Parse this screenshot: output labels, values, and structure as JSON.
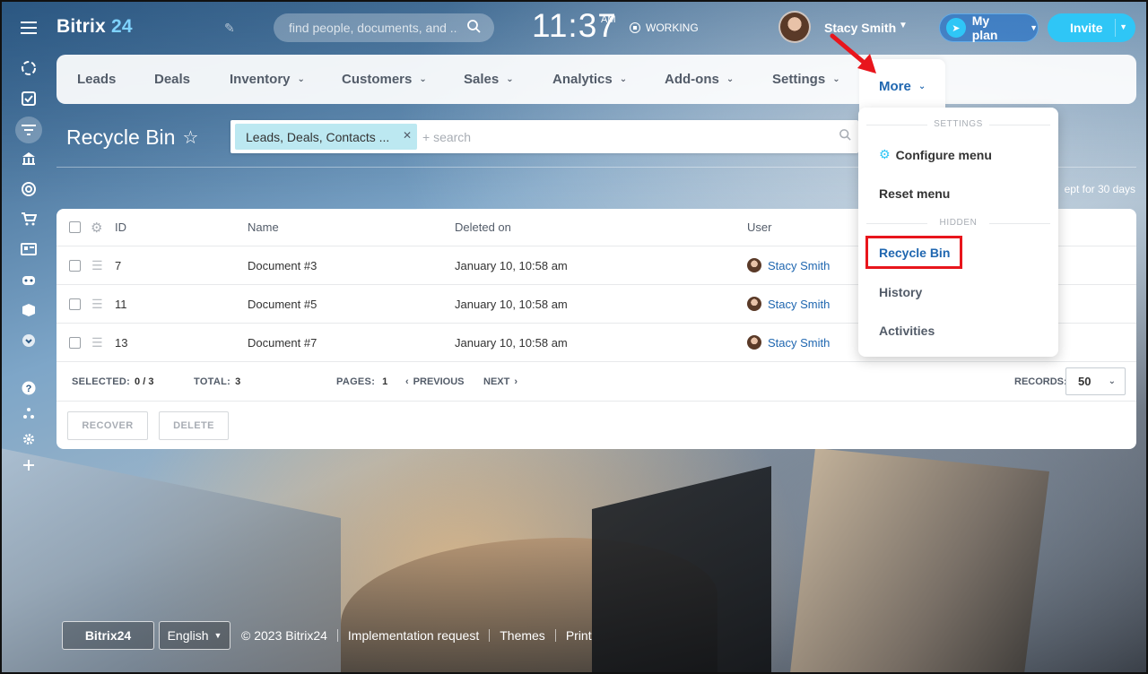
{
  "header": {
    "brand_main": "Bitrix",
    "brand_num": "24",
    "search_placeholder": "find people, documents, and ...",
    "time": "11:37",
    "ampm": "AM",
    "working_label": "WORKING",
    "user_name": "Stacy Smith",
    "myplan_label": "My plan",
    "invite_label": "Invite"
  },
  "sidebar": {
    "icons": [
      "menu-icon",
      "activity-stream-icon",
      "tasks-icon",
      "crm-icon",
      "bank-icon",
      "target-icon",
      "cart-icon",
      "contacts-card-icon",
      "robot-icon",
      "box-icon",
      "chevron-more-icon",
      "help-icon",
      "sitemap-icon",
      "gear-icon",
      "plus-icon"
    ]
  },
  "tabs": [
    {
      "label": "Leads",
      "dropdown": false
    },
    {
      "label": "Deals",
      "dropdown": false
    },
    {
      "label": "Inventory",
      "dropdown": true
    },
    {
      "label": "Customers",
      "dropdown": true
    },
    {
      "label": "Sales",
      "dropdown": true
    },
    {
      "label": "Analytics",
      "dropdown": true
    },
    {
      "label": "Add-ons",
      "dropdown": true
    },
    {
      "label": "Settings",
      "dropdown": true
    },
    {
      "label": "More",
      "dropdown": true
    }
  ],
  "page": {
    "title": "Recycle Bin",
    "filter_chip": "Leads, Deals, Contacts ...",
    "filter_placeholder": "+ search",
    "kept_note": "ept for 30 days"
  },
  "grid": {
    "columns": [
      "ID",
      "Name",
      "Deleted on",
      "User"
    ],
    "rows": [
      {
        "id": "7",
        "name": "Document #3",
        "deleted_on": "January 10, 10:58 am",
        "user": "Stacy Smith"
      },
      {
        "id": "11",
        "name": "Document #5",
        "deleted_on": "January 10, 10:58 am",
        "user": "Stacy Smith"
      },
      {
        "id": "13",
        "name": "Document #7",
        "deleted_on": "January 10, 10:58 am",
        "user": "Stacy Smith"
      }
    ],
    "footer": {
      "selected_label": "SELECTED:",
      "selected_value": "0 / 3",
      "total_label": "TOTAL:",
      "total_value": "3",
      "pages_label": "PAGES:",
      "pages_value": "1",
      "previous_label": "PREVIOUS",
      "next_label": "NEXT",
      "records_label": "RECORDS:",
      "records_value": "50"
    },
    "buttons": {
      "recover": "RECOVER",
      "delete": "DELETE"
    }
  },
  "menu": {
    "section_settings": "SETTINGS",
    "configure": "Configure menu",
    "reset": "Reset menu",
    "section_hidden": "HIDDEN",
    "recycle_bin": "Recycle Bin",
    "history": "History",
    "activities": "Activities"
  },
  "footer": {
    "logo": "Bitrix24",
    "language": "English",
    "copyright": "© 2023 Bitrix24",
    "implementation": "Implementation request",
    "themes": "Themes",
    "print": "Print"
  },
  "colors": {
    "accent_blue": "#2067b0",
    "invite_cyan": "#2fc6f6",
    "highlight_red": "#e8151c"
  }
}
